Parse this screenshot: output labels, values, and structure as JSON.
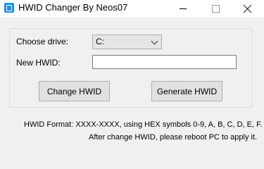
{
  "window": {
    "title": "HWID Changer By Neos07"
  },
  "form": {
    "drive_label": "Choose drive:",
    "drive_value": "C:",
    "hwid_label": "New HWID:",
    "hwid_value": "",
    "change_button": "Change HWID",
    "generate_button": "Generate HWID"
  },
  "info": {
    "line1": "HWID Format: XXXX-XXXX, using HEX symbols 0-9, A, B, C, D, E, F.",
    "line2": "After change HWID, please reboot PC to apply it."
  }
}
